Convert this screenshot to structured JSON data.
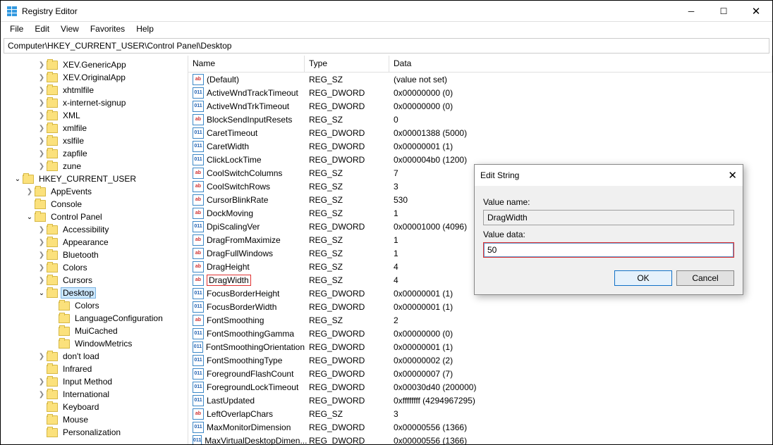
{
  "window": {
    "title": "Registry Editor"
  },
  "menu": {
    "file": "File",
    "edit": "Edit",
    "view": "View",
    "favorites": "Favorites",
    "help": "Help"
  },
  "address": "Computer\\HKEY_CURRENT_USER\\Control Panel\\Desktop",
  "tree": {
    "items_top": [
      "XEV.GenericApp",
      "XEV.OriginalApp",
      "xhtmlfile",
      "x-internet-signup",
      "XML",
      "xmlfile",
      "xslfile",
      "zapfile",
      "zune"
    ],
    "hkcu": "HKEY_CURRENT_USER",
    "hkcu_children": [
      {
        "n": "AppEvents",
        "e": ">"
      },
      {
        "n": "Console",
        "e": ""
      },
      {
        "n": "Control Panel",
        "e": "v",
        "sel": false
      }
    ],
    "cp_children": [
      "Accessibility",
      "Appearance",
      "Bluetooth",
      "Colors",
      "Cursors"
    ],
    "desktop": "Desktop",
    "desktop_children": [
      "Colors",
      "LanguageConfiguration",
      "MuiCached",
      "WindowMetrics"
    ],
    "cp_after": [
      {
        "n": "don't load",
        "e": ">"
      },
      {
        "n": "Infrared",
        "e": ""
      },
      {
        "n": "Input Method",
        "e": ">"
      },
      {
        "n": "International",
        "e": ">"
      },
      {
        "n": "Keyboard",
        "e": ""
      },
      {
        "n": "Mouse",
        "e": ""
      },
      {
        "n": "Personalization",
        "e": ""
      }
    ]
  },
  "list": {
    "headers": {
      "name": "Name",
      "type": "Type",
      "data": "Data"
    },
    "rows": [
      {
        "icon": "sz",
        "name": "(Default)",
        "type": "REG_SZ",
        "data": "(value not set)"
      },
      {
        "icon": "dw",
        "name": "ActiveWndTrackTimeout",
        "type": "REG_DWORD",
        "data": "0x00000000 (0)"
      },
      {
        "icon": "dw",
        "name": "ActiveWndTrkTimeout",
        "type": "REG_DWORD",
        "data": "0x00000000 (0)"
      },
      {
        "icon": "sz",
        "name": "BlockSendInputResets",
        "type": "REG_SZ",
        "data": "0"
      },
      {
        "icon": "dw",
        "name": "CaretTimeout",
        "type": "REG_DWORD",
        "data": "0x00001388 (5000)"
      },
      {
        "icon": "dw",
        "name": "CaretWidth",
        "type": "REG_DWORD",
        "data": "0x00000001 (1)"
      },
      {
        "icon": "dw",
        "name": "ClickLockTime",
        "type": "REG_DWORD",
        "data": "0x000004b0 (1200)"
      },
      {
        "icon": "sz",
        "name": "CoolSwitchColumns",
        "type": "REG_SZ",
        "data": "7"
      },
      {
        "icon": "sz",
        "name": "CoolSwitchRows",
        "type": "REG_SZ",
        "data": "3"
      },
      {
        "icon": "sz",
        "name": "CursorBlinkRate",
        "type": "REG_SZ",
        "data": "530"
      },
      {
        "icon": "sz",
        "name": "DockMoving",
        "type": "REG_SZ",
        "data": "1"
      },
      {
        "icon": "dw",
        "name": "DpiScalingVer",
        "type": "REG_DWORD",
        "data": "0x00001000 (4096)"
      },
      {
        "icon": "sz",
        "name": "DragFromMaximize",
        "type": "REG_SZ",
        "data": "1"
      },
      {
        "icon": "sz",
        "name": "DragFullWindows",
        "type": "REG_SZ",
        "data": "1"
      },
      {
        "icon": "sz",
        "name": "DragHeight",
        "type": "REG_SZ",
        "data": "4"
      },
      {
        "icon": "sz",
        "name": "DragWidth",
        "type": "REG_SZ",
        "data": "4",
        "hl": true
      },
      {
        "icon": "dw",
        "name": "FocusBorderHeight",
        "type": "REG_DWORD",
        "data": "0x00000001 (1)"
      },
      {
        "icon": "dw",
        "name": "FocusBorderWidth",
        "type": "REG_DWORD",
        "data": "0x00000001 (1)"
      },
      {
        "icon": "sz",
        "name": "FontSmoothing",
        "type": "REG_SZ",
        "data": "2"
      },
      {
        "icon": "dw",
        "name": "FontSmoothingGamma",
        "type": "REG_DWORD",
        "data": "0x00000000 (0)"
      },
      {
        "icon": "dw",
        "name": "FontSmoothingOrientation",
        "type": "REG_DWORD",
        "data": "0x00000001 (1)"
      },
      {
        "icon": "dw",
        "name": "FontSmoothingType",
        "type": "REG_DWORD",
        "data": "0x00000002 (2)"
      },
      {
        "icon": "dw",
        "name": "ForegroundFlashCount",
        "type": "REG_DWORD",
        "data": "0x00000007 (7)"
      },
      {
        "icon": "dw",
        "name": "ForegroundLockTimeout",
        "type": "REG_DWORD",
        "data": "0x00030d40 (200000)"
      },
      {
        "icon": "dw",
        "name": "LastUpdated",
        "type": "REG_DWORD",
        "data": "0xffffffff (4294967295)"
      },
      {
        "icon": "sz",
        "name": "LeftOverlapChars",
        "type": "REG_SZ",
        "data": "3"
      },
      {
        "icon": "dw",
        "name": "MaxMonitorDimension",
        "type": "REG_DWORD",
        "data": "0x00000556 (1366)"
      },
      {
        "icon": "dw",
        "name": "MaxVirtualDesktopDimen...",
        "type": "REG_DWORD",
        "data": "0x00000556 (1366)"
      }
    ]
  },
  "dialog": {
    "title": "Edit String",
    "name_label": "Value name:",
    "name_value": "DragWidth",
    "data_label": "Value data:",
    "data_value": "50",
    "ok": "OK",
    "cancel": "Cancel"
  }
}
